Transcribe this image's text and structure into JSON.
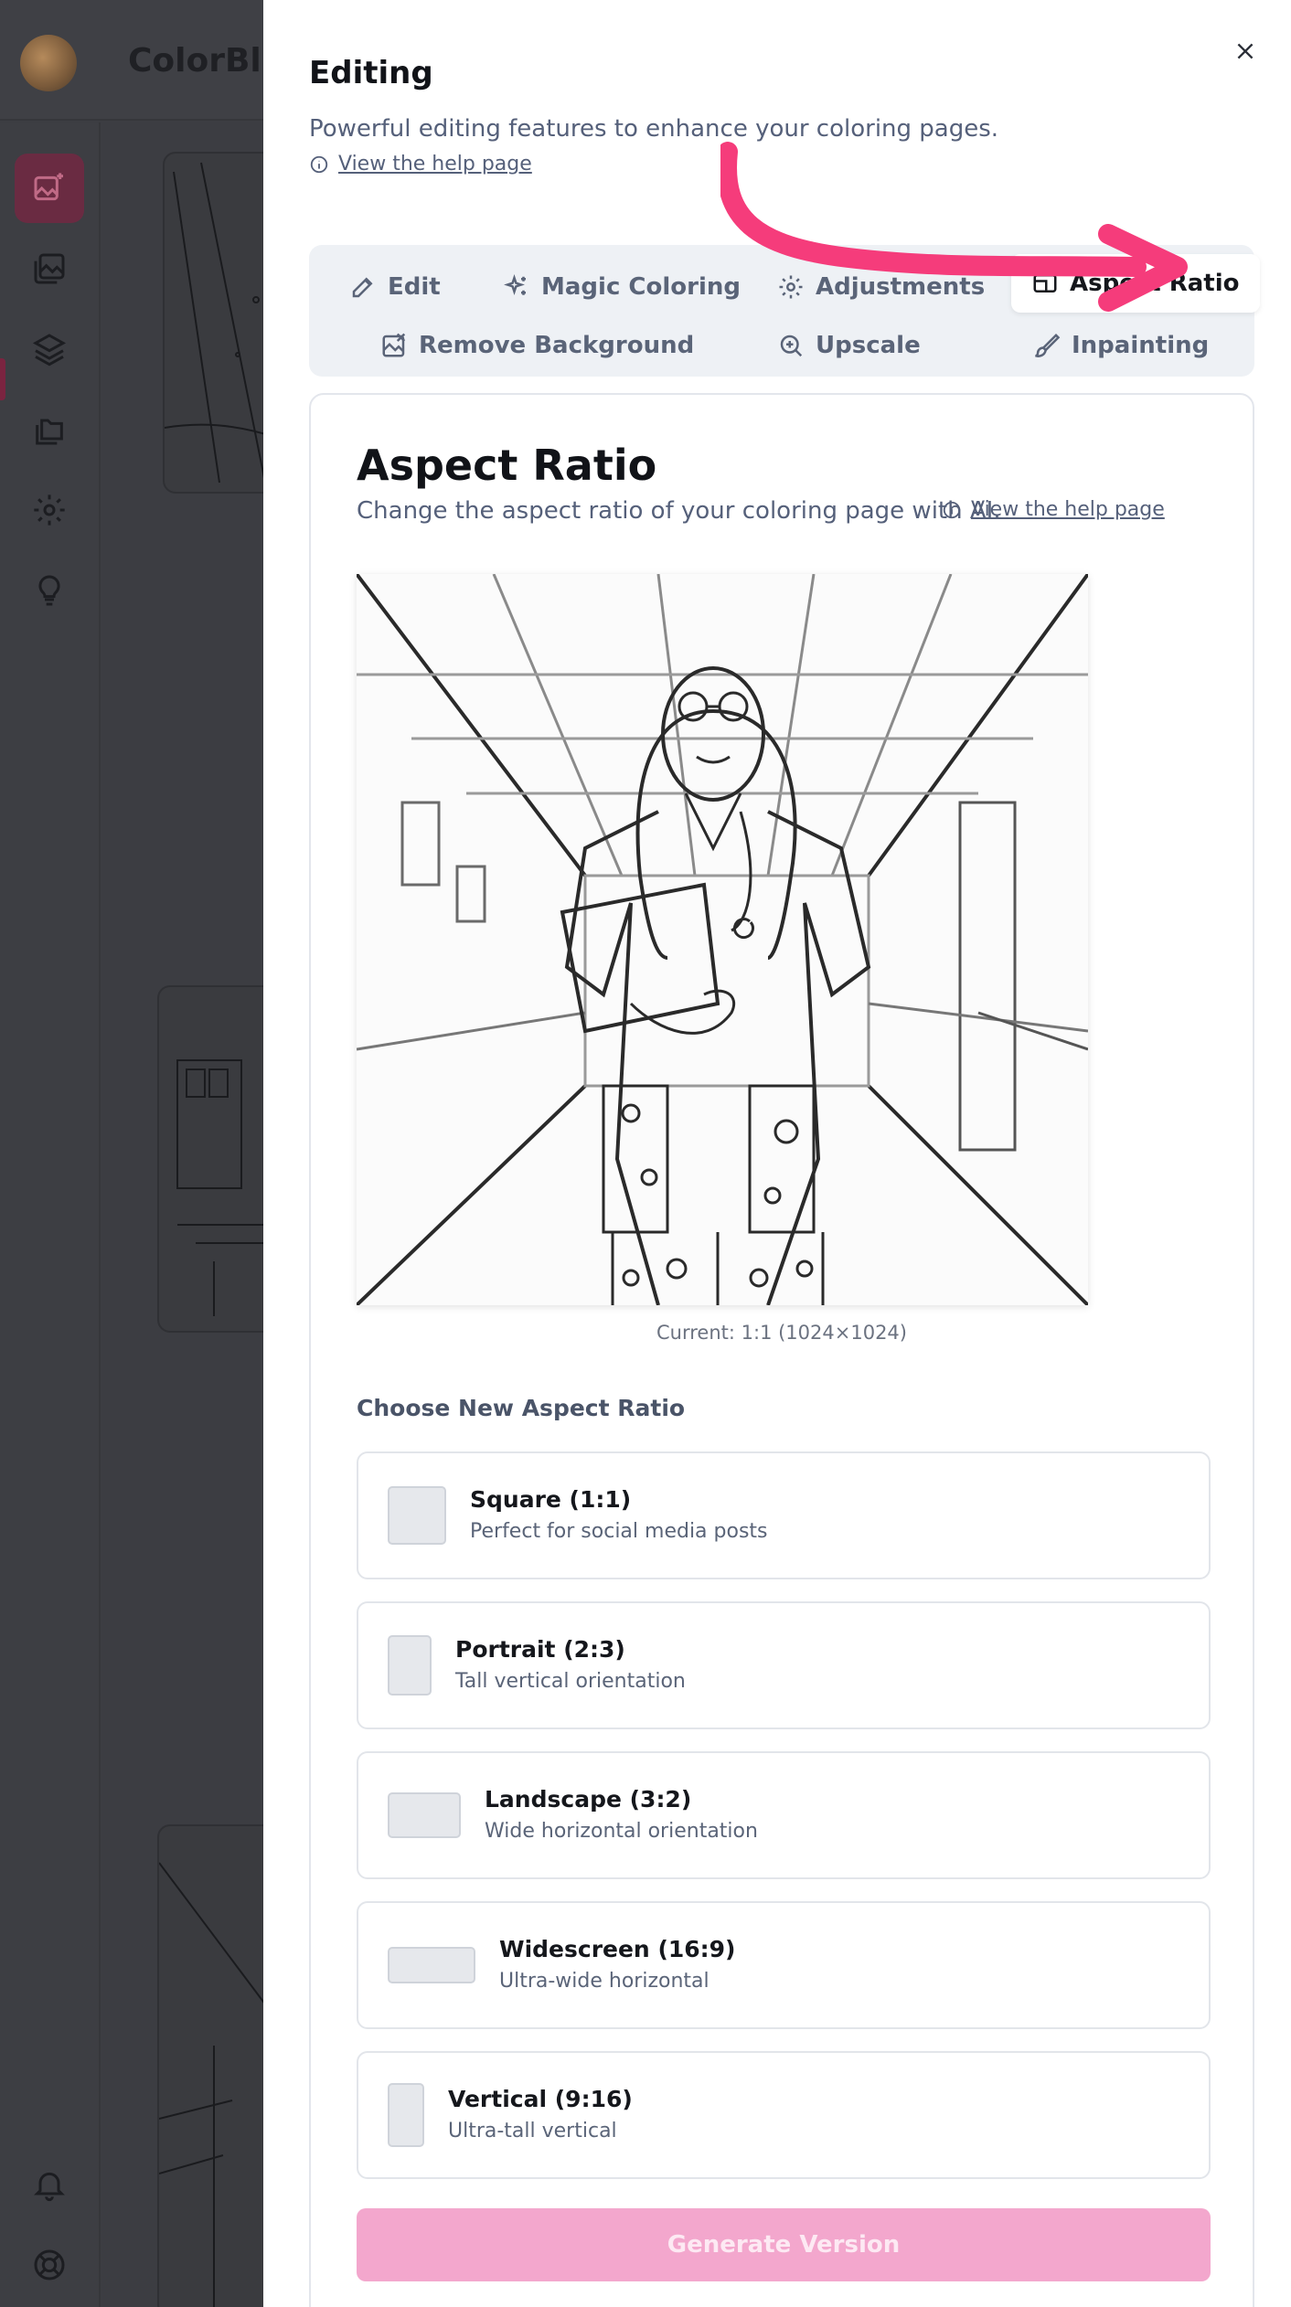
{
  "app": {
    "brand": "ColorBlis"
  },
  "sidebar": {
    "icons": [
      "image-sparkle-icon",
      "gallery-icon",
      "layers-icon",
      "folders-icon",
      "settings-icon",
      "lightbulb-icon",
      "bell-icon",
      "lifebuoy-icon"
    ]
  },
  "panel": {
    "title": "Editing",
    "subtitle": "Powerful editing features to enhance your coloring pages.",
    "help_link": "View the help page",
    "tabs": [
      {
        "label": "Edit",
        "icon": "pencil-icon"
      },
      {
        "label": "Magic Coloring",
        "icon": "sparkles-icon"
      },
      {
        "label": "Adjustments",
        "icon": "gear-icon"
      },
      {
        "label": "Aspect Ratio",
        "icon": "aspect-ratio-icon",
        "active": true
      },
      {
        "label": "Remove Background",
        "icon": "image-remove-icon"
      },
      {
        "label": "Upscale",
        "icon": "zoom-in-icon"
      },
      {
        "label": "Inpainting",
        "icon": "brush-icon"
      }
    ]
  },
  "aspect": {
    "title": "Aspect Ratio",
    "description": "Change the aspect ratio of your coloring page with AI.",
    "help_link": "View the help page",
    "current": "Current: 1:1 (1024×1024)",
    "choose_label": "Choose New Aspect Ratio",
    "options": [
      {
        "name": "Square (1:1)",
        "desc": "Perfect for social media posts"
      },
      {
        "name": "Portrait (2:3)",
        "desc": "Tall vertical orientation"
      },
      {
        "name": "Landscape (3:2)",
        "desc": "Wide horizontal orientation"
      },
      {
        "name": "Widescreen (16:9)",
        "desc": "Ultra-wide horizontal"
      },
      {
        "name": "Vertical (9:16)",
        "desc": "Ultra-tall vertical"
      }
    ],
    "generate_label": "Generate Version"
  },
  "colors": {
    "accent": "#f3a7cd",
    "arrow": "#f53c7b",
    "overlay": "#3c3d42"
  }
}
